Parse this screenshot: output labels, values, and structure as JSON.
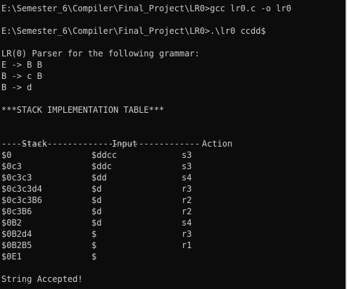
{
  "commands": [
    {
      "prompt": "E:\\Semester_6\\Compiler\\Final_Project\\LR0>",
      "command": "gcc lr0.c -o lr0"
    },
    {
      "prompt": "E:\\Semester_6\\Compiler\\Final_Project\\LR0>",
      "command": ".\\lr0 ccdd$"
    }
  ],
  "parser_title": "LR(0) Parser for the following grammar:",
  "grammar": [
    "E -> B B",
    "B -> c B",
    "B -> d"
  ],
  "table_title": "***STACK IMPLEMENTATION TABLE***",
  "table": {
    "headers": [
      "Stack",
      "Input",
      "Action"
    ],
    "divider": "---------------------------------------",
    "rows": [
      [
        "$0",
        "$ddcc",
        "s3"
      ],
      [
        "$0c3",
        "$ddc",
        "s3"
      ],
      [
        "$0c3c3",
        "$dd",
        "s4"
      ],
      [
        "$0c3c3d4",
        "$d",
        "r3"
      ],
      [
        "$0c3c3B6",
        "$d",
        "r2"
      ],
      [
        "$0c3B6",
        "$d",
        "r2"
      ],
      [
        "$0B2",
        "$d",
        "s4"
      ],
      [
        "$0B2d4",
        "$",
        "r3"
      ],
      [
        "$0B2B5",
        "$",
        "r1"
      ],
      [
        "$0E1",
        "$",
        ""
      ]
    ]
  },
  "result": "String Accepted!"
}
